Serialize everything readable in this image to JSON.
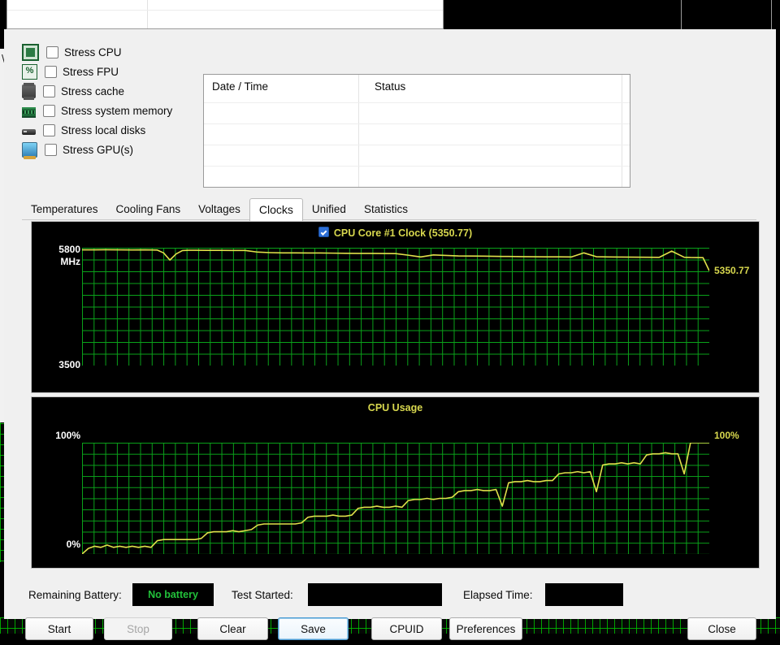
{
  "dialog": {
    "stress_options": [
      {
        "label": "Stress CPU",
        "icon": "cpu-icon",
        "checked": false
      },
      {
        "label": "Stress FPU",
        "icon": "fpu-icon",
        "checked": false
      },
      {
        "label": "Stress cache",
        "icon": "cache-icon",
        "checked": false
      },
      {
        "label": "Stress system memory",
        "icon": "memory-icon",
        "checked": false
      },
      {
        "label": "Stress local disks",
        "icon": "disk-icon",
        "checked": false
      },
      {
        "label": "Stress GPU(s)",
        "icon": "gpu-icon",
        "checked": false
      }
    ],
    "log_table": {
      "columns": [
        "Date / Time",
        "Status"
      ],
      "rows": []
    },
    "tabs": [
      {
        "label": "Temperatures",
        "active": false
      },
      {
        "label": "Cooling Fans",
        "active": false
      },
      {
        "label": "Voltages",
        "active": false
      },
      {
        "label": "Clocks",
        "active": true
      },
      {
        "label": "Unified",
        "active": false
      },
      {
        "label": "Statistics",
        "active": false
      }
    ],
    "status": {
      "battery_label": "Remaining Battery:",
      "battery_value": "No battery",
      "battery_color": "#22c13a",
      "test_started_label": "Test Started:",
      "test_started_value": "",
      "elapsed_label": "Elapsed Time:",
      "elapsed_value": ""
    },
    "buttons": [
      {
        "name": "start",
        "label": "Start",
        "state": "enabled"
      },
      {
        "name": "stop",
        "label": "Stop",
        "state": "disabled"
      },
      {
        "name": "clear",
        "label": "Clear",
        "state": "enabled"
      },
      {
        "name": "save",
        "label": "Save",
        "state": "focused"
      },
      {
        "name": "cpuid",
        "label": "CPUID",
        "state": "enabled"
      },
      {
        "name": "preferences",
        "label": "Preferences",
        "state": "enabled"
      },
      {
        "name": "close",
        "label": "Close",
        "state": "enabled"
      }
    ]
  },
  "chart_data": [
    {
      "type": "line",
      "title": "CPU Core #1 Clock (5350.77)",
      "legend_checked": true,
      "series_name": "CPU Core #1 Clock",
      "current_value": "5350.77",
      "right_label": "5350.77",
      "ylabel": "MHz",
      "ytick_top": "5800",
      "ytick_top_unit": "MHz",
      "ytick_bottom": "3500",
      "ylim": [
        3500,
        5800
      ],
      "grid": true,
      "line_color": "#e0e04a",
      "grid_color": "#0aa21a",
      "bg_color": "#000000",
      "x": [
        0,
        2,
        4,
        6,
        8,
        10,
        12,
        13,
        14,
        15,
        16,
        17,
        18,
        20,
        22,
        24,
        26,
        28,
        30,
        32,
        34,
        36,
        38,
        40,
        42,
        44,
        46,
        48,
        50,
        52,
        54,
        56,
        58,
        60,
        62,
        64,
        65,
        66,
        67,
        68,
        69,
        70,
        72,
        74,
        76,
        78,
        80,
        82,
        84,
        86,
        88,
        90,
        92,
        94,
        96,
        97,
        98,
        99,
        100
      ],
      "values": [
        5760,
        5760,
        5762,
        5760,
        5758,
        5760,
        5755,
        5700,
        5560,
        5680,
        5745,
        5752,
        5752,
        5750,
        5750,
        5748,
        5748,
        5715,
        5705,
        5700,
        5700,
        5698,
        5698,
        5695,
        5692,
        5690,
        5690,
        5688,
        5686,
        5655,
        5620,
        5660,
        5650,
        5640,
        5638,
        5636,
        5634,
        5632,
        5630,
        5630,
        5628,
        5626,
        5624,
        5622,
        5622,
        5620,
        5700,
        5625,
        5620,
        5618,
        5616,
        5614,
        5612,
        5735,
        5615,
        5610,
        5608,
        5606,
        5350
      ]
    },
    {
      "type": "line",
      "title": "CPU Usage",
      "ylabel": "%",
      "ytick_top": "100%",
      "ytick_bottom": "0%",
      "right_label": "100%",
      "ylim": [
        0,
        100
      ],
      "grid": true,
      "line_color": "#e0e04a",
      "grid_color": "#0aa21a",
      "bg_color": "#000000",
      "x": [
        0,
        1,
        2,
        3,
        4,
        5,
        6,
        7,
        8,
        9,
        10,
        11,
        12,
        13,
        14,
        15,
        16,
        17,
        18,
        19,
        20,
        21,
        22,
        23,
        24,
        25,
        26,
        27,
        28,
        29,
        30,
        31,
        32,
        33,
        34,
        35,
        36,
        37,
        38,
        39,
        40,
        41,
        42,
        43,
        44,
        45,
        46,
        47,
        48,
        49,
        50,
        51,
        52,
        53,
        54,
        55,
        56,
        57,
        58,
        59,
        60,
        61,
        62,
        63,
        64,
        65,
        66,
        67,
        68,
        69,
        70,
        71,
        72,
        73,
        74,
        75,
        76,
        77,
        78,
        79,
        80,
        81,
        82,
        83,
        84,
        85,
        86,
        87,
        88,
        89,
        90,
        91,
        92,
        93,
        94,
        95,
        96,
        97,
        98,
        99,
        100
      ],
      "values": [
        0,
        5,
        7,
        6,
        8,
        6,
        7,
        6,
        7,
        6,
        7,
        6,
        12,
        13,
        13,
        13,
        13,
        13,
        13,
        14,
        19,
        20,
        20,
        20,
        21,
        20,
        21,
        22,
        26,
        27,
        27,
        27,
        27,
        27,
        27,
        28,
        33,
        34,
        34,
        34,
        35,
        34,
        34,
        35,
        41,
        42,
        42,
        43,
        42,
        42,
        43,
        42,
        48,
        49,
        49,
        50,
        49,
        50,
        50,
        51,
        56,
        57,
        57,
        58,
        57,
        57,
        58,
        43,
        64,
        65,
        65,
        66,
        65,
        65,
        66,
        66,
        72,
        73,
        73,
        74,
        73,
        74,
        56,
        80,
        81,
        81,
        82,
        81,
        82,
        81,
        89,
        90,
        90,
        91,
        90,
        90,
        72,
        100,
        100,
        100,
        100
      ]
    }
  ]
}
